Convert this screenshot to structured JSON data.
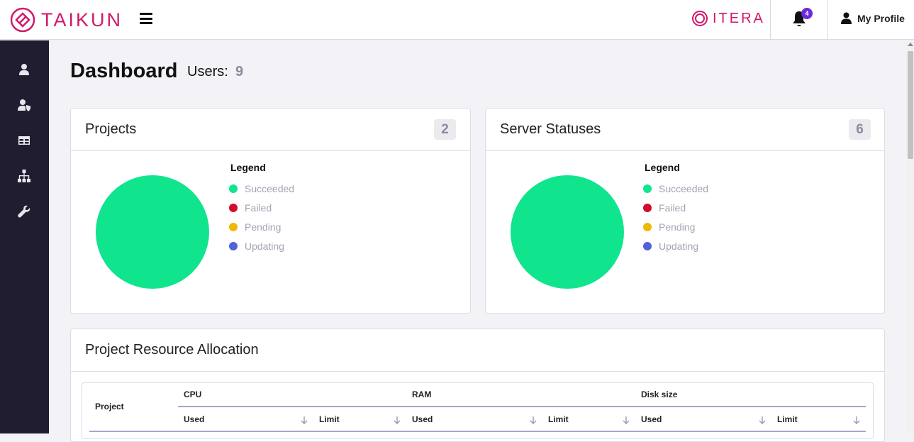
{
  "brand": {
    "name": "TAIKUN",
    "partner": "ITERA",
    "color": "#d1196c"
  },
  "topbar": {
    "notification_count": "4",
    "profile_label": "My Profile"
  },
  "sidebar": {
    "items": [
      {
        "icon": "user-icon"
      },
      {
        "icon": "user-shield-icon"
      },
      {
        "icon": "table-icon"
      },
      {
        "icon": "sitemap-icon"
      },
      {
        "icon": "wrench-icon"
      }
    ]
  },
  "header": {
    "title": "Dashboard",
    "users_label": "Users:",
    "users_count": "9"
  },
  "projects_card": {
    "title": "Projects",
    "count": "2",
    "legend_title": "Legend",
    "legend": [
      {
        "label": "Succeeded",
        "color": "#10e58d"
      },
      {
        "label": "Failed",
        "color": "#d40a2e"
      },
      {
        "label": "Pending",
        "color": "#f2b705"
      },
      {
        "label": "Updating",
        "color": "#5561d6"
      }
    ]
  },
  "servers_card": {
    "title": "Server Statuses",
    "count": "6",
    "legend_title": "Legend",
    "legend": [
      {
        "label": "Succeeded",
        "color": "#10e58d"
      },
      {
        "label": "Failed",
        "color": "#d40a2e"
      },
      {
        "label": "Pending",
        "color": "#f2b705"
      },
      {
        "label": "Updating",
        "color": "#5561d6"
      }
    ]
  },
  "resource_card": {
    "title": "Project Resource Allocation",
    "table": {
      "project_header": "Project",
      "groups": [
        "CPU",
        "RAM",
        "Disk size"
      ],
      "subheaders": [
        "Used",
        "Limit",
        "Used",
        "Limit",
        "Used",
        "Limit"
      ]
    }
  }
}
